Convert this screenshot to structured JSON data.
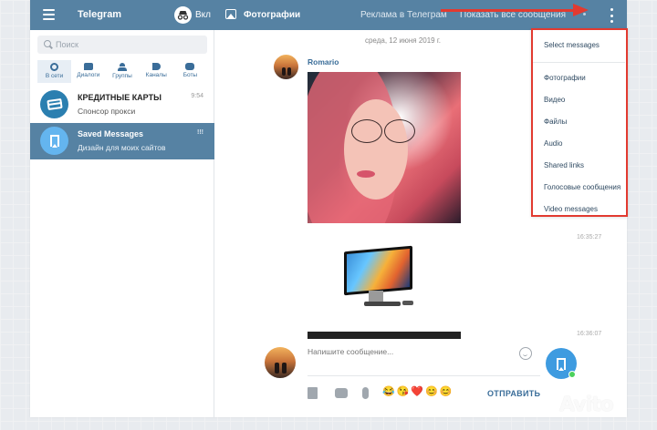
{
  "topbar": {
    "app_title": "Telegram",
    "incognito_label": "Вкл",
    "peer_title": "Фотографии",
    "promo_link": "Реклама в Телеграм",
    "show_all_link": "Показать все сообщения",
    "color": "#5682a3"
  },
  "sidebar": {
    "search_placeholder": "Поиск",
    "tabs": [
      {
        "label": "В сети",
        "icon": "online-icon",
        "active": true
      },
      {
        "label": "Диалоги",
        "icon": "dialogs-icon"
      },
      {
        "label": "Группы",
        "icon": "groups-icon"
      },
      {
        "label": "Каналы",
        "icon": "channels-icon"
      },
      {
        "label": "Боты",
        "icon": "bots-icon"
      }
    ],
    "chats": [
      {
        "name": "КРЕДИТНЫЕ КАРТЫ",
        "subtitle": "Спонсор прокси",
        "time": "9:54",
        "icon": "credit-card-icon"
      },
      {
        "name": "Saved Messages",
        "subtitle": "Дизайн для моих сайтов",
        "time": "!!!",
        "icon": "bookmark-icon",
        "selected": true
      }
    ]
  },
  "main": {
    "date_separator": "среда, 12 июня 2019 г.",
    "sender_name": "Romario",
    "time_1": "16:35:27",
    "time_2": "16:36:07"
  },
  "composer": {
    "placeholder": "Напишите сообщение...",
    "emojis": "😂😘❤️😊😊",
    "send_label": "ОТПРАВИТЬ"
  },
  "menu": {
    "items": [
      "Select messages",
      "Фотографии",
      "Видео",
      "Файлы",
      "Audio",
      "Shared links",
      "Голосовые сообщения",
      "Video messages"
    ],
    "highlight_color": "#e23a30"
  },
  "watermark": "Avito"
}
